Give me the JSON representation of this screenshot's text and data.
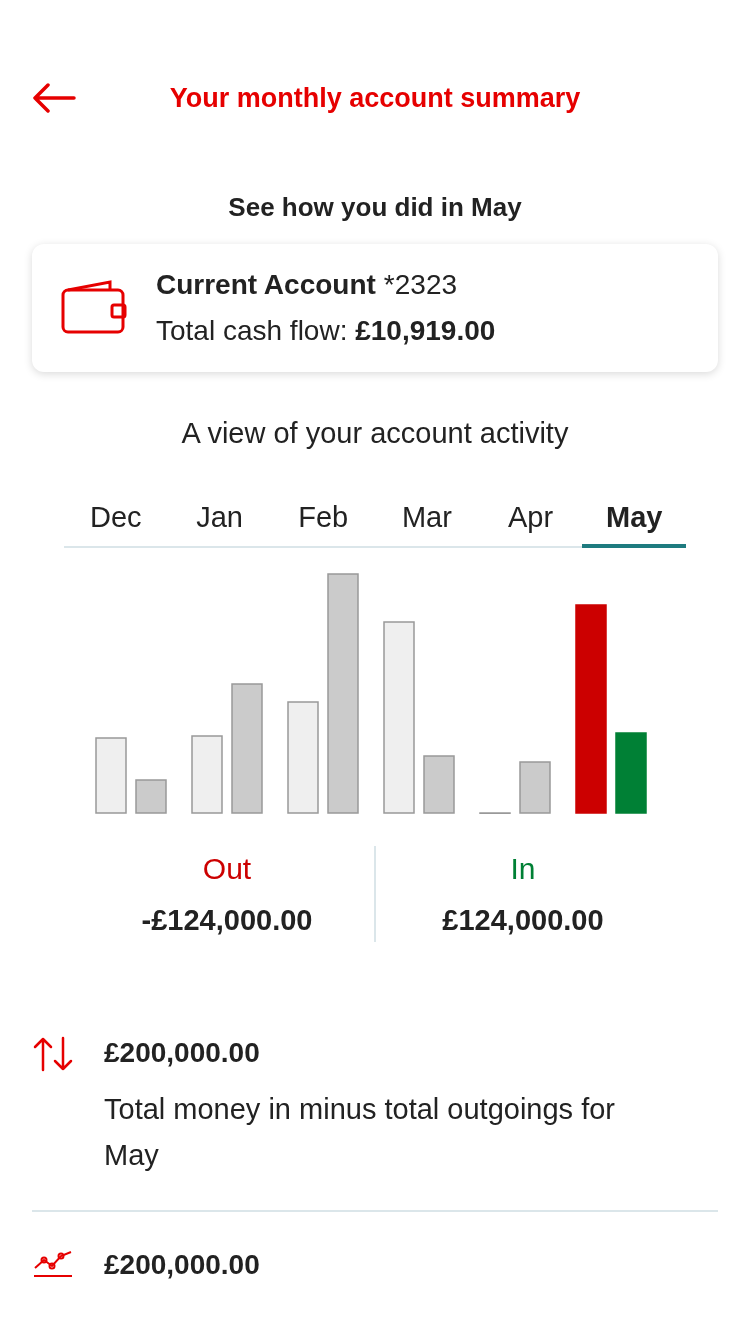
{
  "header": {
    "title": "Your monthly account summary"
  },
  "subtitle": "See how you did in May",
  "account": {
    "name": "Current Account",
    "number": "*2323",
    "cash_flow": "Total cash flow: **£10,919.00**"
  },
  "activity_title": "A view of your account activity",
  "tabs": [
    {
      "label": "Dec",
      "selected": false
    },
    {
      "label": "Jan",
      "selected": false
    },
    {
      "label": "Feb",
      "selected": false
    },
    {
      "label": "Mar",
      "selected": false
    },
    {
      "label": "Apr",
      "selected": false
    },
    {
      "label": "May",
      "selected": true
    }
  ],
  "totals": [
    {
      "kind": "out",
      "label": "Out",
      "amount": "-£124,000.00"
    },
    {
      "kind": "in",
      "label": "In",
      "amount": "£124,000.00"
    }
  ],
  "items": [
    {
      "kind": "net",
      "amount": "£200,000.00",
      "description": "Total money in minus total outgoings for May"
    },
    {
      "kind": "trend",
      "amount": "£200,000.00"
    }
  ]
}
